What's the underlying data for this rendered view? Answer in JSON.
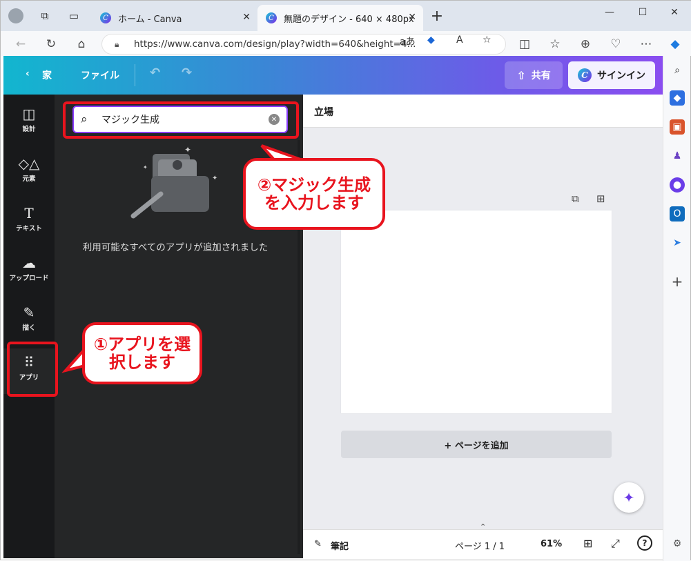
{
  "browser": {
    "tabs": [
      {
        "label": "ホーム - Canva"
      },
      {
        "label": "無題のデザイン - 640 × 480px"
      }
    ],
    "url": "https://www.canva.com/design/play?width=640&height=4...",
    "reader_label": "aあ"
  },
  "header": {
    "home_label": "家",
    "file_label": "ファイル",
    "share_label": "共有",
    "signin_label": "サインイン"
  },
  "rail": {
    "items": [
      {
        "label": "設計",
        "icon": "layout-icon"
      },
      {
        "label": "元素",
        "icon": "elements-icon"
      },
      {
        "label": "テキスト",
        "icon": "text-icon"
      },
      {
        "label": "アップロード",
        "icon": "upload-icon"
      },
      {
        "label": "描く",
        "icon": "draw-icon"
      },
      {
        "label": "アプリ",
        "icon": "apps-grid-icon"
      }
    ]
  },
  "panel": {
    "search_value": "マジック生成",
    "message": "利用可能なすべてのアプリが追加されました"
  },
  "workarea": {
    "title": "立場",
    "add_page_label": "+ ページを追加"
  },
  "footer": {
    "notes_label": "筆記",
    "page_label": "ページ 1 / 1",
    "zoom": "61%"
  },
  "annotations": {
    "callout1": "①アプリを選\n択します",
    "callout2": "②マジック生成\nを入力します"
  },
  "colors": {
    "accent": "#8b3dff",
    "annotation_red": "#e8141e"
  }
}
